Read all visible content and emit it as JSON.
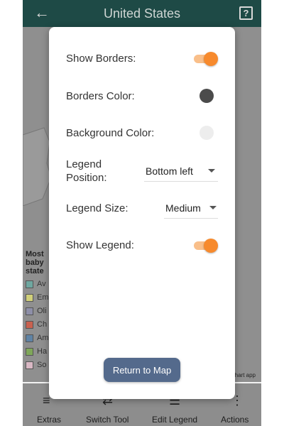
{
  "header": {
    "title": "United States",
    "back_icon": "arrow-left-icon",
    "help_icon": "help-square-icon",
    "help_glyph": "?"
  },
  "background_legend": {
    "title": "Most baby state",
    "items": [
      {
        "label": "Av",
        "color": "#6fa7a0"
      },
      {
        "label": "Em",
        "color": "#d1d07a"
      },
      {
        "label": "Oli",
        "color": "#8e8fa8"
      },
      {
        "label": "Ch sta",
        "color": "#c9614f"
      },
      {
        "label": "Am",
        "color": "#5f83a5"
      },
      {
        "label": "Ha",
        "color": "#7fa75a"
      },
      {
        "label": "So",
        "color": "#d9b8c4"
      }
    ],
    "credit": "chart app"
  },
  "bottom_tabs": [
    {
      "label": "Extras",
      "icon": "sliders-icon"
    },
    {
      "label": "Switch Tool",
      "icon": "switch-icon"
    },
    {
      "label": "Edit Legend",
      "icon": "list-icon"
    },
    {
      "label": "Actions",
      "icon": "more-vertical-icon"
    }
  ],
  "dialog": {
    "show_borders": {
      "label": "Show Borders:",
      "on": true
    },
    "borders_color": {
      "label": "Borders Color:",
      "color": "#4b4b4b"
    },
    "background_color": {
      "label": "Background Color:",
      "color": "#ededed"
    },
    "legend_position": {
      "label_line1": "Legend",
      "label_line2": "Position:",
      "value": "Bottom left"
    },
    "legend_size": {
      "label": "Legend Size:",
      "value": "Medium"
    },
    "show_legend": {
      "label": "Show Legend:",
      "on": true
    },
    "return_button": "Return to Map"
  },
  "colors": {
    "accent": "#f78a2d",
    "header": "#1e4a46",
    "button": "#546a8c"
  }
}
